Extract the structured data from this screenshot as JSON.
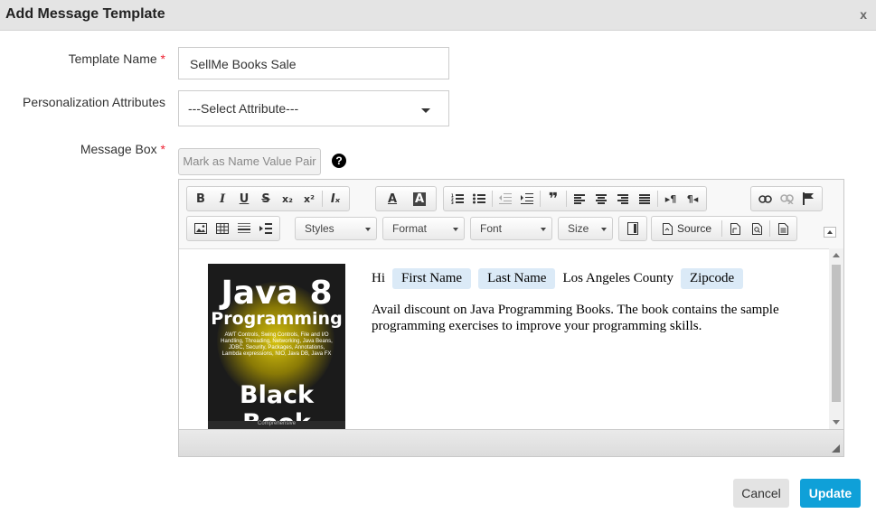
{
  "dialog": {
    "title": "Add Message Template",
    "close_label": "x"
  },
  "form": {
    "template_name_label": "Template Name",
    "required_mark": "*",
    "template_name_value": "SellMe Books Sale",
    "personalization_label": "Personalization Attributes",
    "personalization_value": "---Select Attribute---",
    "message_box_label": "Message Box",
    "mark_button": "Mark as Name Value Pair",
    "help_icon": "?"
  },
  "toolbar": {
    "row1": {
      "bold": "B",
      "italic": "I",
      "underline": "U",
      "strike": "S",
      "subscript": "x₂",
      "superscript": "x²",
      "remove_format": "Iₓ",
      "text_color": "A",
      "bg_color": "A",
      "quote": "❞",
      "paragraph_ltr": "▸¶",
      "paragraph_rtl": "¶◂"
    },
    "combos": {
      "styles": "Styles",
      "format": "Format",
      "font": "Font",
      "size": "Size"
    },
    "source_label": "Source"
  },
  "content": {
    "greeting": "Hi",
    "tags": [
      "First Name",
      "Last Name"
    ],
    "location": "Los Angeles County",
    "tag_zip": "Zipcode",
    "paragraph": "Avail discount on Java Programming Books. The book contains the sample programming exercises to improve your programming skills.",
    "book": {
      "title_line1": "Java 8",
      "title_line2": "Programming",
      "subtitle": "AWT Controls, Swing Controls, File and I/O Handling, Threading, Networking, Java Beans, JDBC, Security, Packages, Annotations, Lambda expressions, NIO, Java DB, Java FX",
      "title_line3": "Black Book",
      "footer": "Comprehensive"
    }
  },
  "actions": {
    "cancel": "Cancel",
    "update": "Update"
  }
}
